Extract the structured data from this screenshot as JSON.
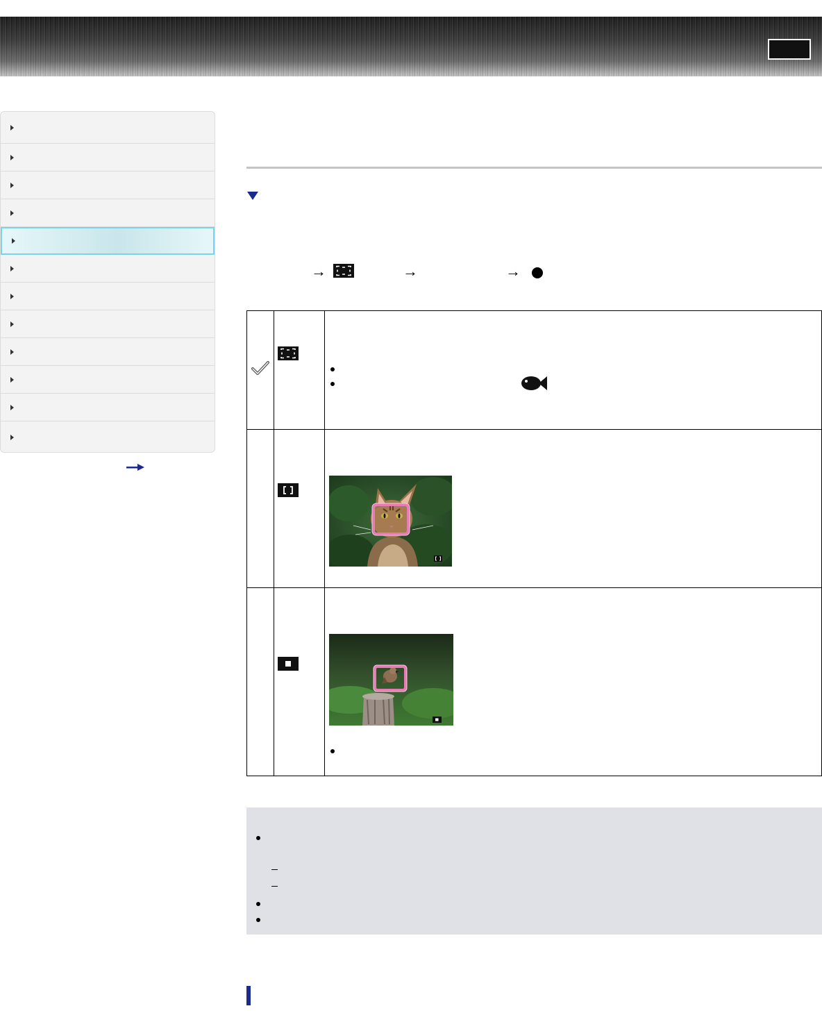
{
  "header": {
    "bar_icon": "striped-banner",
    "top_button_label": ""
  },
  "sidebar": {
    "items": [
      {
        "label": ""
      },
      {
        "label": ""
      },
      {
        "label": ""
      },
      {
        "label": ""
      },
      {
        "label": "",
        "active": true
      },
      {
        "label": ""
      },
      {
        "label": ""
      },
      {
        "label": ""
      },
      {
        "label": ""
      },
      {
        "label": ""
      },
      {
        "label": ""
      },
      {
        "label": ""
      }
    ],
    "more_icon": "arrow-right-icon"
  },
  "content": {
    "page_title": "",
    "section_toggle_icon": "triangle-down-icon",
    "menu_path": {
      "steps": [
        "→",
        "→",
        "→"
      ],
      "icons": [
        "wide-focus-icon",
        "dot-icon"
      ]
    },
    "options": [
      {
        "checked": true,
        "icon": "wide-focus-icon",
        "text": "",
        "bullets": [
          "",
          ""
        ],
        "inline_icon": "fish-icon"
      },
      {
        "checked": false,
        "icon": "center-focus-icon",
        "text": "",
        "image": "cat-face-photo"
      },
      {
        "checked": false,
        "icon": "spot-focus-icon",
        "text": "",
        "image": "bird-on-post-photo",
        "bullets": [
          ""
        ]
      }
    ],
    "notes": {
      "bullets": [
        "",
        "",
        ""
      ],
      "sub_dashes": [
        "",
        ""
      ]
    },
    "accent_color": "#1b2a8f"
  }
}
